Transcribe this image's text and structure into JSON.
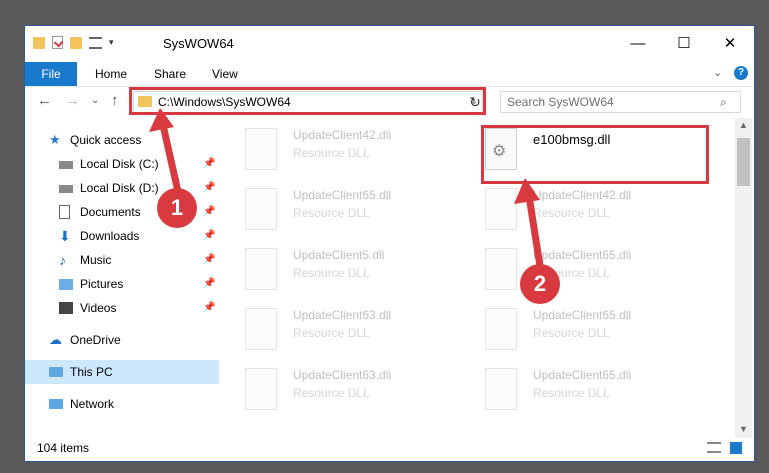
{
  "window": {
    "title": "SysWOW64"
  },
  "ribbon": {
    "tabs": [
      "File",
      "Home",
      "Share",
      "View"
    ]
  },
  "address": {
    "path": "C:\\Windows\\SysWOW64"
  },
  "search": {
    "placeholder": "Search SysWOW64"
  },
  "nav": {
    "quick_access": "Quick access",
    "items": [
      {
        "label": "Local Disk (C:)",
        "icon": "drive-icon"
      },
      {
        "label": "Local Disk (D:)",
        "icon": "drive-icon"
      },
      {
        "label": "Documents",
        "icon": "documents-icon"
      },
      {
        "label": "Downloads",
        "icon": "download-icon"
      },
      {
        "label": "Music",
        "icon": "music-icon"
      },
      {
        "label": "Pictures",
        "icon": "pictures-icon"
      },
      {
        "label": "Videos",
        "icon": "videos-icon"
      }
    ],
    "onedrive": "OneDrive",
    "thispc": "This PC",
    "network": "Network"
  },
  "files": {
    "col1": [
      {
        "name": "UpdateClient42.dll",
        "desc": "Resource DLL"
      },
      {
        "name": "UpdateClient65.dll",
        "desc": "Resource DLL"
      },
      {
        "name": "UpdateClient5.dll",
        "desc": "Resource DLL"
      },
      {
        "name": "UpdateClient63.dll",
        "desc": "Resource DLL"
      },
      {
        "name": "UpdateClient63.dll",
        "desc": "Resource DLL"
      }
    ],
    "col2": [
      {
        "name": "e100bmsg.dll",
        "desc": ""
      },
      {
        "name": "UpdateClient42.dll",
        "desc": "Resource DLL"
      },
      {
        "name": "UpdateClient65.dll",
        "desc": "Resource DLL"
      },
      {
        "name": "UpdateClient65.dll",
        "desc": "Resource DLL"
      },
      {
        "name": "UpdateClient65.dll",
        "desc": "Resource DLL"
      }
    ]
  },
  "status": {
    "count": "104 items"
  },
  "annotations": {
    "badge1": "1",
    "badge2": "2"
  },
  "colors": {
    "accent": "#1979ca",
    "annotation_red": "#d6393f"
  }
}
